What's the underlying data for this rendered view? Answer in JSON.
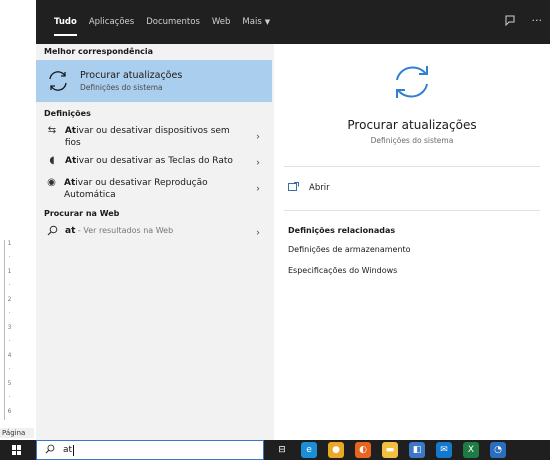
{
  "background_app": {
    "page_label": "Página",
    "ruler_marks": [
      "1",
      "·",
      "1",
      "·",
      "2",
      "·",
      "3",
      "·",
      "4",
      "·",
      "5",
      "·",
      "6"
    ]
  },
  "tabs": [
    {
      "label": "Tudo",
      "active": true
    },
    {
      "label": "Aplicações",
      "active": false
    },
    {
      "label": "Documentos",
      "active": false
    },
    {
      "label": "Web",
      "active": false
    },
    {
      "label": "Mais",
      "active": false,
      "has_caret": true
    }
  ],
  "top_right": {
    "feedback_icon": "feedback-icon",
    "more_icon": "more-icon",
    "more_glyph": "···"
  },
  "left": {
    "best_match_heading": "Melhor correspondência",
    "best_match": {
      "title": "Procurar atualizações",
      "subtitle": "Definições do sistema",
      "icon": "sync-icon"
    },
    "settings_heading": "Definições",
    "settings_items": [
      {
        "bold": "At",
        "rest": "ivar ou desativar dispositivos sem fios",
        "icon": "network-icon",
        "glyph": "⇆"
      },
      {
        "bold": "At",
        "rest": "ivar ou desativar as Teclas do Rato",
        "icon": "mouse-icon",
        "glyph": "◖"
      },
      {
        "bold": "At",
        "rest": "ivar ou desativar Reprodução Automática",
        "icon": "autoplay-icon",
        "glyph": "◉"
      }
    ],
    "web_heading": "Procurar na Web",
    "web_item": {
      "bold": "at",
      "rest": " - Ver resultados na Web",
      "icon": "search-icon"
    }
  },
  "right": {
    "title": "Procurar atualizações",
    "subtitle": "Definições do sistema",
    "open_label": "Abrir",
    "related_heading": "Definições relacionadas",
    "related_links": [
      "Definições de armazenamento",
      "Especificações do Windows"
    ]
  },
  "taskbar": {
    "search_value": "at",
    "icons": [
      {
        "name": "task-view-icon",
        "color": "#1f1f1f",
        "glyph": "⊟"
      },
      {
        "name": "edge-icon",
        "color": "#1a8fd6",
        "glyph": "e"
      },
      {
        "name": "chrome-icon",
        "color": "#e9a825",
        "glyph": "●"
      },
      {
        "name": "firefox-icon",
        "color": "#e8651f",
        "glyph": "◐"
      },
      {
        "name": "file-explorer-icon",
        "color": "#f1c040",
        "glyph": "▬"
      },
      {
        "name": "store-icon",
        "color": "#3b78c8",
        "glyph": "◧"
      },
      {
        "name": "mail-icon",
        "color": "#1479cc",
        "glyph": "✉"
      },
      {
        "name": "excel-icon",
        "color": "#1f7b45",
        "glyph": "X"
      },
      {
        "name": "outlook-icon",
        "color": "#2a6fbf",
        "glyph": "◔"
      }
    ]
  },
  "colors": {
    "accent": "#aacfee",
    "topbar": "#202020",
    "taskbar": "#1f1f1f",
    "link_icon": "#3a6ea5"
  }
}
